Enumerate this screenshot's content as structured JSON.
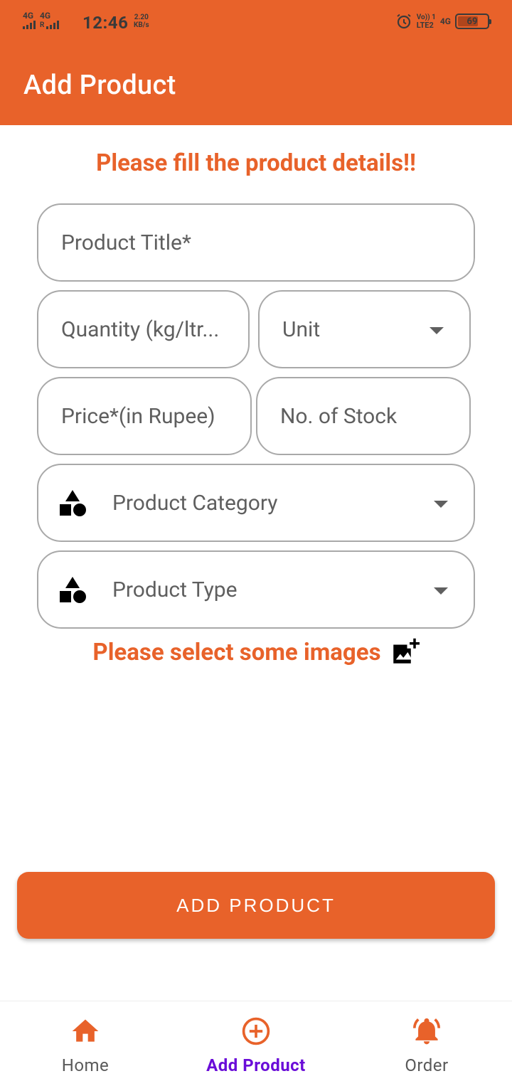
{
  "status_bar": {
    "net1": "4G",
    "net2": "4G",
    "net2_sub": "R",
    "time": "12:46",
    "speed_value": "2.20",
    "speed_unit": "KB/s",
    "volte_line1": "Vo)) 1",
    "volte_line2": "LTE2",
    "net3": "4G",
    "battery": "69",
    "battery_level": 0.69
  },
  "appbar": {
    "title": "Add Product"
  },
  "form": {
    "heading": "Please fill the product details!!",
    "product_title_placeholder": "Product Title*",
    "quantity_placeholder": "Quantity (kg/ltr...",
    "unit_placeholder": "Unit",
    "price_placeholder": "Price*(in Rupee)",
    "stock_placeholder": "No. of Stock",
    "category_placeholder": "Product Category",
    "type_placeholder": "Product Type",
    "images_prompt": "Please select some images",
    "submit_label": "ADD PRODUCT"
  },
  "colors": {
    "accent": "#E8622A",
    "active_nav": "#6a0dd8",
    "field_border": "#a9a9a9"
  },
  "bottom_nav": {
    "items": [
      {
        "label": "Home",
        "icon": "home-icon",
        "active": false
      },
      {
        "label": "Add Product",
        "icon": "add-circle-icon",
        "active": true
      },
      {
        "label": "Order",
        "icon": "bell-ring-icon",
        "active": false
      }
    ]
  }
}
